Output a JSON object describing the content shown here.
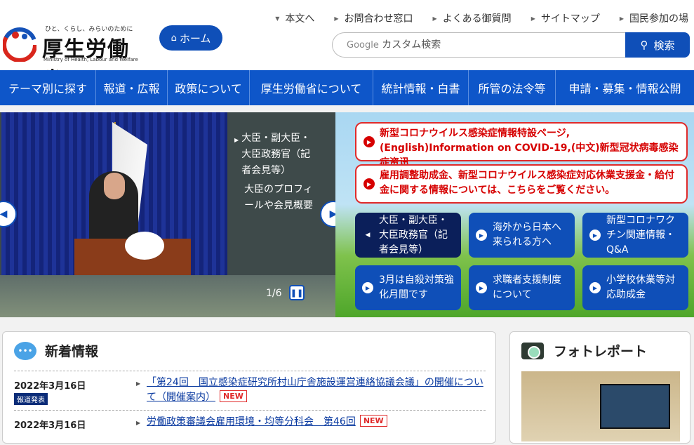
{
  "header": {
    "tagline": "ひと、くらし、みらいのために",
    "ministry_name": "厚生労働省",
    "ministry_en": "Ministry of Health, Labour and Welfare",
    "home_label": "ホーム",
    "util_links": [
      "本文へ",
      "お問合わせ窓口",
      "よくある御質問",
      "サイトマップ",
      "国民参加の場"
    ],
    "search_google": "Google",
    "search_placeholder": "カスタム検索",
    "search_button": "検索"
  },
  "nav": {
    "items": [
      "テーマ別に探す",
      "報道・広報",
      "政策について",
      "厚生労働省について",
      "統計情報・白書",
      "所管の法令等",
      "申請・募集・情報公開"
    ]
  },
  "slider": {
    "caption_title": "大臣・副大臣・大臣政務官（記者会見等）",
    "caption_desc": "大臣のプロフィールや会見概要",
    "counter": "1/6"
  },
  "notices": [
    "新型コロナウイルス感染症情報特設ページ,(English)Information on COVID-19,(中文)新型冠状病毒感染症资讯",
    "雇用調整助成金、新型コロナウイルス感染症対応休業支援金・給付金に関する情報については、こちらをご覧ください。"
  ],
  "tiles": [
    "大臣・副大臣・大臣政務官（記者会見等）",
    "海外から日本へ来られる方へ",
    "新型コロナワクチン関連情報・Q&A",
    "3月は自殺対策強化月間です",
    "求職者支援制度について",
    "小学校休業等対応助成金"
  ],
  "news": {
    "title": "新着情報",
    "rows": [
      {
        "date": "2022年3月16日",
        "badge": "報道発表",
        "text": "「第24回　国立感染症研究所村山庁舎施設運営連絡協議会議」の開催について（開催案内）",
        "new": "NEW"
      },
      {
        "date": "2022年3月16日",
        "badge": "",
        "text": "労働政策審議会雇用環境・均等分科会　第46回",
        "new": "NEW"
      }
    ]
  },
  "photo_report": {
    "title": "フォトレポート"
  }
}
